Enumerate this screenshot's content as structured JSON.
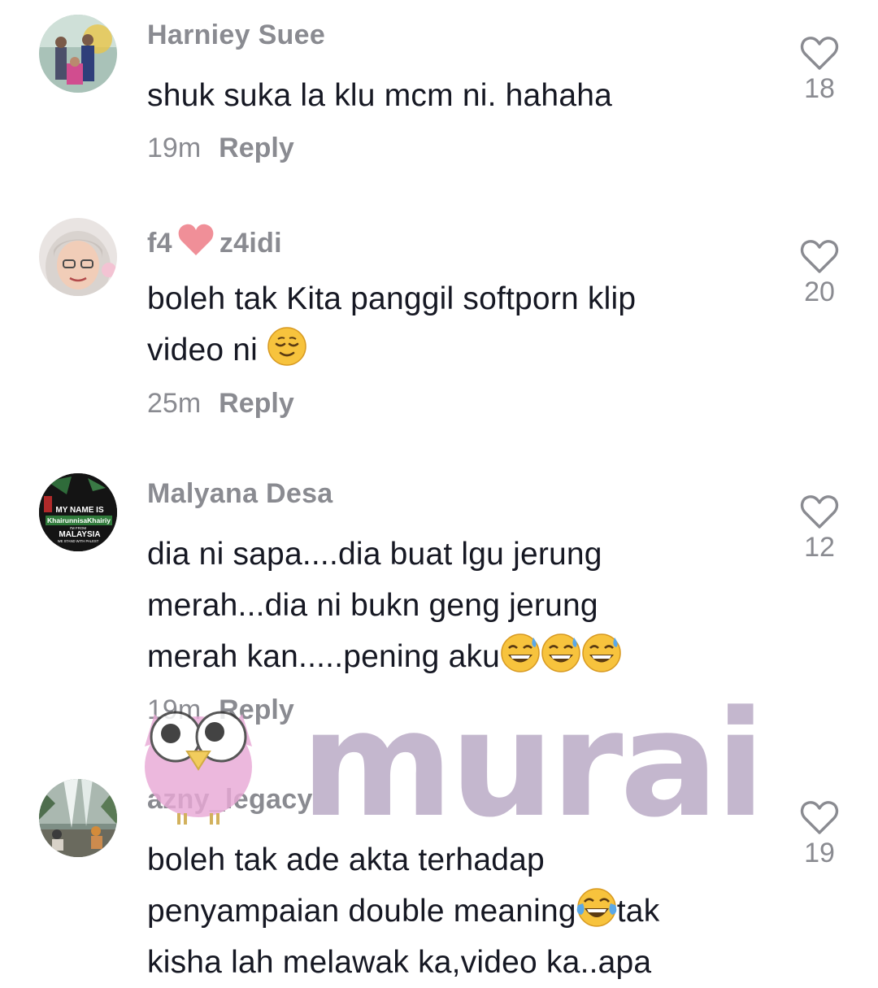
{
  "comments": [
    {
      "username": "Harniey Suee",
      "text": "shuk suka la klu mcm ni. hahaha",
      "time": "19m",
      "reply_label": "Reply",
      "likes": "18",
      "avatar": "family-photo-avatar"
    },
    {
      "username_part1": "f4",
      "username_part2": "z4idi",
      "line1": "boleh tak Kita panggil softporn klip",
      "line2": "video ni",
      "time": "25m",
      "reply_label": "Reply",
      "likes": "20",
      "avatar": "selfie-avatar"
    },
    {
      "username": "Malyana Desa",
      "line1": "dia ni sapa....dia buat lgu jerung",
      "line2": "merah...dia ni bukn geng jerung",
      "line3": "merah kan.....pening aku",
      "time": "19m",
      "reply_label": "Reply",
      "likes": "12",
      "avatar_text": {
        "l1": "MY NAME IS",
        "l2": "KhairunnisaKhairiy",
        "l3": "I'M FROM",
        "l4": "MALAYSIA",
        "l5": "WE STAND WITH PALEST"
      }
    },
    {
      "username": "azny_legacy",
      "line1": "boleh tak ade akta terhadap",
      "line2": "penyampaian double meaning",
      "line2b": "tak",
      "line3": "kisha lah melawak ka,video ka..apa",
      "likes": "19",
      "avatar": "waterfall-avatar"
    }
  ],
  "watermark": {
    "text": "murai",
    "mascot": "owl-mascot-icon"
  },
  "colors": {
    "text": "#161823",
    "muted": "#8a8b91",
    "heart_outline": "#8a8b91"
  }
}
